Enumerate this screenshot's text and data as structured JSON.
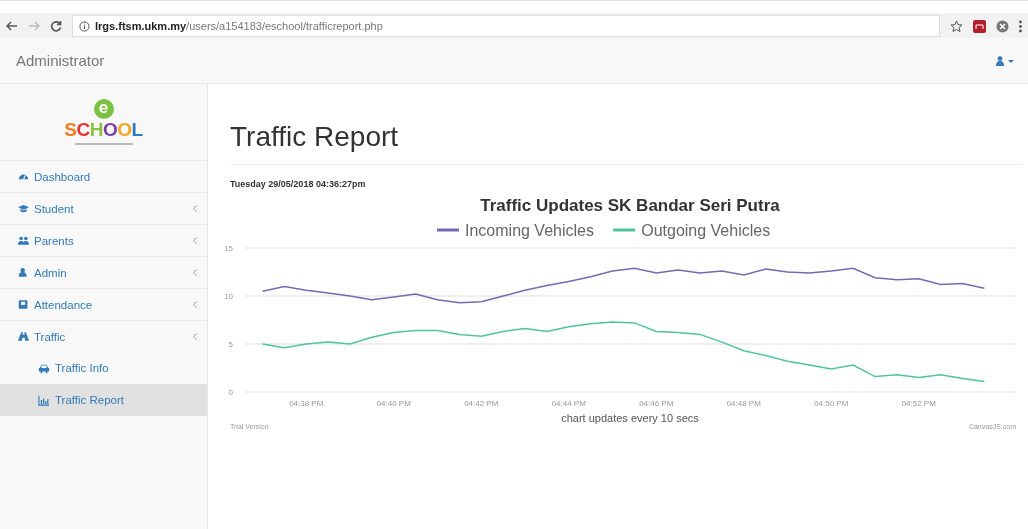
{
  "browser": {
    "url": "**lrgs.ftsm.ukm.my**/users/a154183/eschool/trafficreport.php"
  },
  "navbar": {
    "brand": "Administrator"
  },
  "logo": {
    "badge": "e",
    "name": "SCHOOL"
  },
  "sidebar": {
    "items": [
      {
        "label": "Dashboard",
        "kind": "link",
        "selected": false
      },
      {
        "label": "Student",
        "kind": "menu",
        "selected": false
      },
      {
        "label": "Parents",
        "kind": "menu",
        "selected": false
      },
      {
        "label": "Admin",
        "kind": "menu",
        "selected": false
      },
      {
        "label": "Attendance",
        "kind": "menu",
        "selected": false
      },
      {
        "label": "Traffic",
        "kind": "menu",
        "selected": false,
        "children": [
          {
            "label": "Traffic Info",
            "selected": false
          },
          {
            "label": "Traffic Report",
            "selected": true
          }
        ]
      }
    ]
  },
  "page": {
    "title": "Traffic Report",
    "timestamp": "Tuesday 29/05/2018 04:36:27pm",
    "trial_label": "Trial Version",
    "credit": "CanvasJS.com",
    "chart_data": {
      "type": "line",
      "title": "Traffic Updates SK Bandar Seri Putra",
      "xlabel": "chart updates every 10 secs",
      "categories": [
        null,
        null,
        "04:38 PM",
        null,
        null,
        null,
        "04:40 PM",
        null,
        null,
        null,
        "04:42 PM",
        null,
        null,
        null,
        "04:44 PM",
        null,
        null,
        null,
        "04:46 PM",
        null,
        null,
        null,
        "04:48 PM",
        null,
        null,
        null,
        "04:50 PM",
        null,
        null,
        null,
        "04:52 PM",
        null,
        null,
        null
      ],
      "series": [
        {
          "name": "Incoming Vehicles",
          "color": "#6f6db0",
          "values": [
            10.5,
            11,
            10.6,
            10.3,
            10,
            9.6,
            9.9,
            10.2,
            9.6,
            9.3,
            9.4,
            10,
            10.6,
            11.1,
            11.5,
            12,
            12.6,
            12.9,
            12.4,
            12.7,
            12.4,
            12.6,
            12.2,
            12.8,
            12.5,
            12.4,
            12.6,
            12.9,
            11.9,
            11.7,
            11.8,
            11.2,
            11.3,
            10.8
          ]
        },
        {
          "name": "Outgoing Vehicles",
          "color": "#4fc49c",
          "values": [
            5,
            4.6,
            5,
            5.2,
            5,
            5.7,
            6.2,
            6.4,
            6.4,
            6,
            5.8,
            6.3,
            6.6,
            6.3,
            6.8,
            7.1,
            7.3,
            7.2,
            6.3,
            6.2,
            6,
            5.2,
            4.3,
            3.8,
            3.2,
            2.8,
            2.4,
            2.8,
            1.6,
            1.8,
            1.5,
            1.8,
            1.4,
            1.1
          ]
        }
      ],
      "legend": "top",
      "ylim": [
        0,
        15
      ],
      "yticks": [
        0,
        5,
        10,
        15
      ]
    }
  }
}
